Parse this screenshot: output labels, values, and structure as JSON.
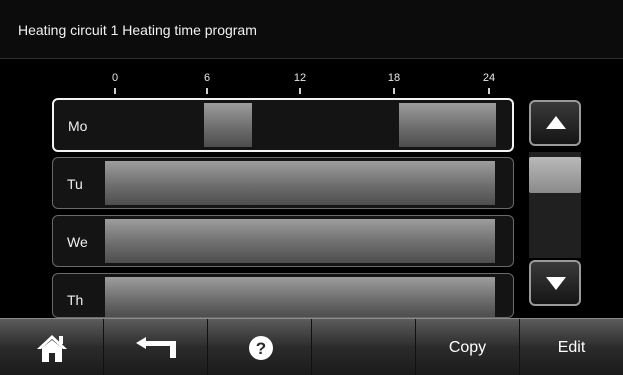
{
  "header": {
    "title": "Heating circuit 1 Heating time program"
  },
  "axis": {
    "ticks": [
      "0",
      "6",
      "12",
      "18",
      "24"
    ]
  },
  "days": [
    {
      "label": "Mo",
      "selected": true,
      "segments": [
        [
          6,
          9
        ],
        [
          18,
          24
        ]
      ]
    },
    {
      "label": "Tu",
      "selected": false,
      "segments": [
        [
          0,
          24
        ]
      ]
    },
    {
      "label": "We",
      "selected": false,
      "segments": [
        [
          0,
          24
        ]
      ]
    },
    {
      "label": "Th",
      "selected": false,
      "segments": [
        [
          0,
          24
        ]
      ]
    }
  ],
  "scrollbar": {
    "up_icon": "arrow-up-icon",
    "down_icon": "arrow-down-icon"
  },
  "bottom_bar": {
    "home_icon": "home-icon",
    "back_icon": "back-arrow-icon",
    "help_icon": "help-icon",
    "copy_label": "Copy",
    "edit_label": "Edit"
  },
  "colors": {
    "background": "#000000",
    "segment": "#7a7a7a",
    "selected_border": "#f4f4f4"
  }
}
